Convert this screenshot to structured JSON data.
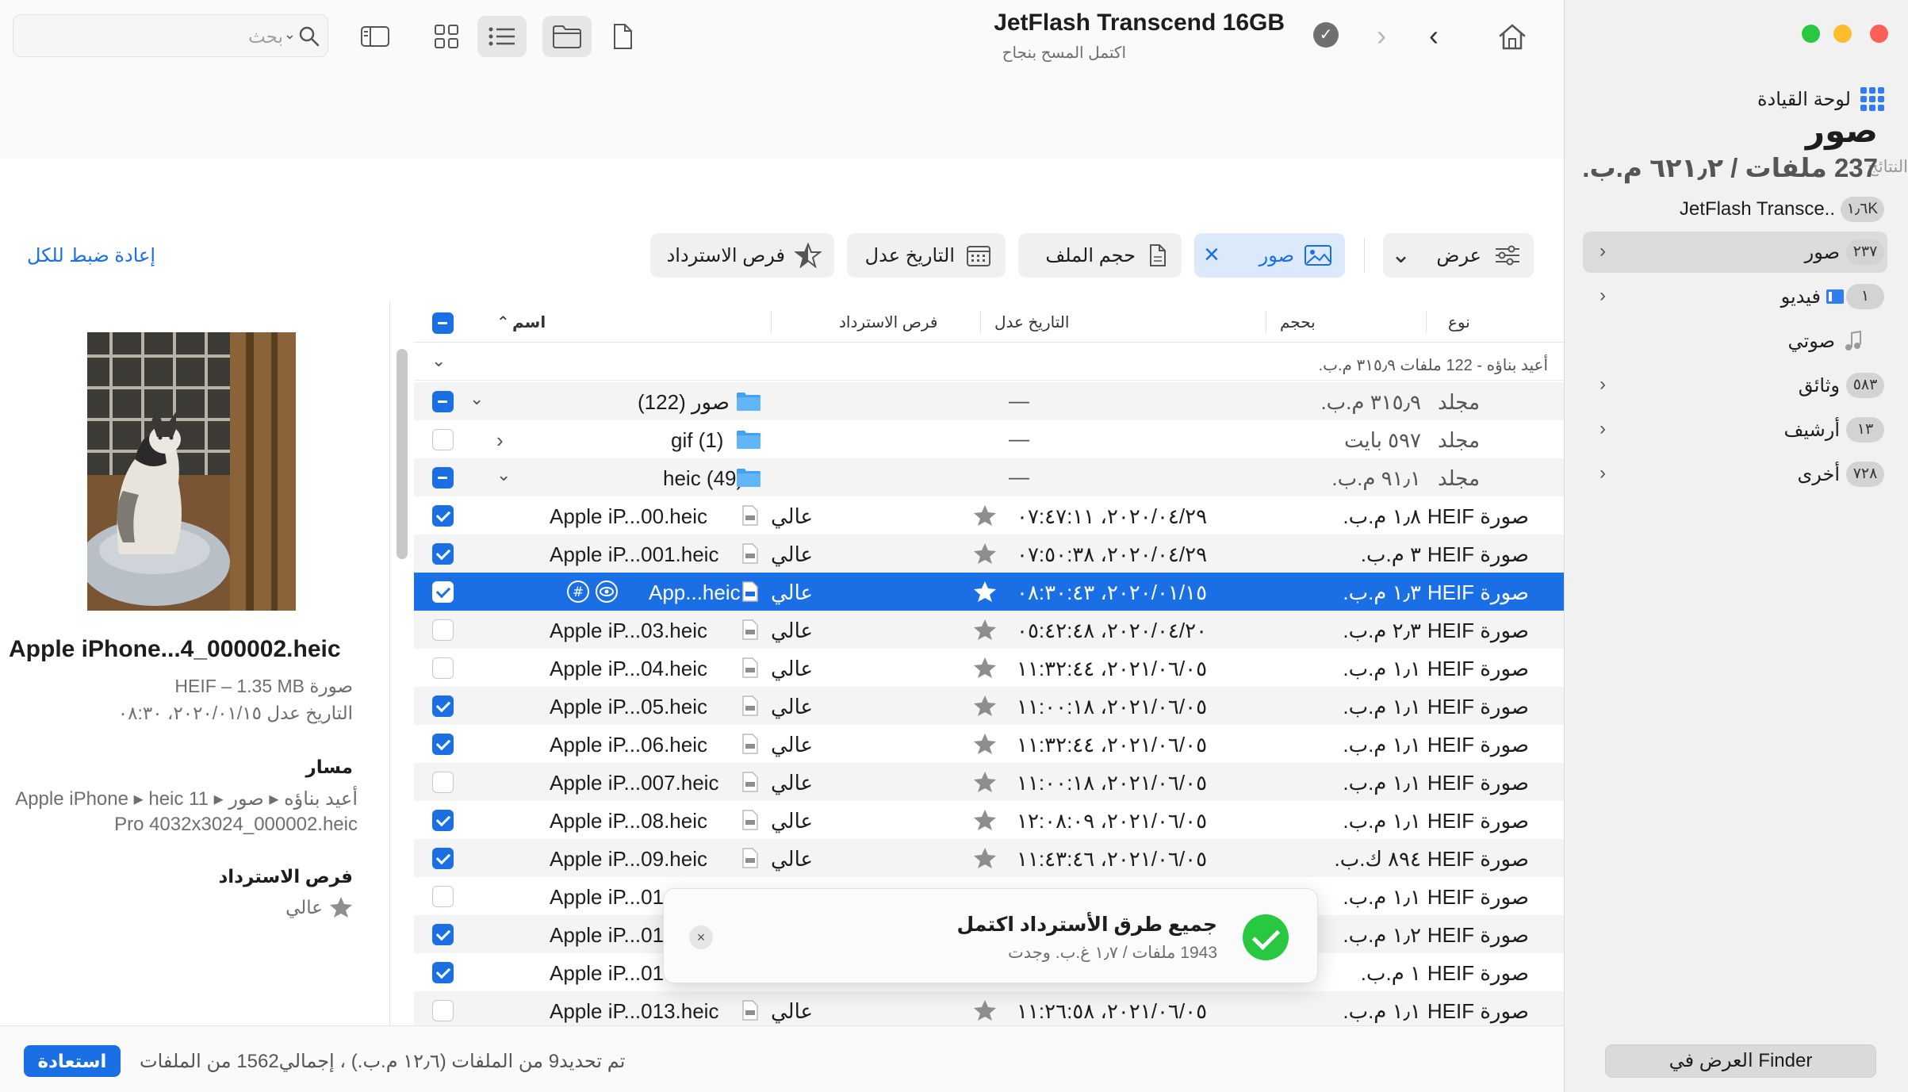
{
  "window": {
    "title": "JetFlash Transcend 16GB",
    "subtitle": "اكتمل المسح بنجاح",
    "search_placeholder": "بحث"
  },
  "page": {
    "title": "صور",
    "summary": "237 ملفات / ٦٢١٫٢ م.ب."
  },
  "sidebar": {
    "dashboard_label": "لوحة القيادة",
    "results_heading": "النتائج",
    "device": {
      "label": "JetFlash Transce..",
      "badge": "١٫٦K"
    },
    "items": [
      {
        "label": "صور",
        "badge": "٢٣٧"
      },
      {
        "label": "فيديو",
        "badge": "١"
      },
      {
        "label": "صوتي",
        "badge": ""
      },
      {
        "label": "وثائق",
        "badge": "٥٨٣"
      },
      {
        "label": "أرشيف",
        "badge": "١٣"
      },
      {
        "label": "أخرى",
        "badge": "٧٢٨"
      }
    ],
    "finder_button": "العرض في Finder"
  },
  "filters": {
    "view": "عرض",
    "photos": "صور",
    "file_size": "حجم الملف",
    "date_modified": "التاريخ عدل",
    "recovery_chances": "فرص الاسترداد",
    "reset_all": "إعادة ضبط للكل"
  },
  "columns": {
    "name": "اسم",
    "recovery": "فرص الاسترداد",
    "date": "التاريخ عدل",
    "size": "بحجم",
    "kind": "نوع"
  },
  "group_header": "أعيد بناؤه - 122 ملفات ٣١٥٫٩ م.ب.",
  "folder_rows": [
    {
      "name": "صور (122)",
      "dash": "—",
      "size": "٣١٥٫٩ م.ب.",
      "kind": "مجلد"
    },
    {
      "name": "gif (1)",
      "dash": "—",
      "size": "٥٩٧ بايت",
      "kind": "مجلد"
    },
    {
      "name": "heic (49)",
      "dash": "—",
      "size": "٩١٫١ م.ب.",
      "kind": "مجلد"
    }
  ],
  "file_rows": [
    {
      "name": "Apple iP...00.heic",
      "chance": "عالي",
      "date": "٢٠٢٠/٠٤/٢٩، ٠٧:٤٧:١١",
      "size": "١٫٨ م.ب.",
      "kind": "صورة HEIF"
    },
    {
      "name": "Apple iP...001.heic",
      "chance": "عالي",
      "date": "٢٠٢٠/٠٤/٢٩، ٠٧:٥٠:٣٨",
      "size": "٣ م.ب.",
      "kind": "صورة HEIF"
    },
    {
      "name": "App...heic",
      "chance": "عالي",
      "date": "٢٠٢٠/٠١/١٥، ٠٨:٣٠:٤٣",
      "size": "١٫٣ م.ب.",
      "kind": "صورة HEIF"
    },
    {
      "name": "Apple iP...03.heic",
      "chance": "عالي",
      "date": "٢٠٢٠/٠٤/٢٠، ٠٥:٤٢:٤٨",
      "size": "٢٫٣ م.ب.",
      "kind": "صورة HEIF"
    },
    {
      "name": "Apple iP...04.heic",
      "chance": "عالي",
      "date": "٢٠٢١/٠٦/٠٥، ١١:٣٢:٤٤",
      "size": "١٫١ م.ب.",
      "kind": "صورة HEIF"
    },
    {
      "name": "Apple iP...05.heic",
      "chance": "عالي",
      "date": "٢٠٢١/٠٦/٠٥، ١١:٠٠:١٨",
      "size": "١٫١ م.ب.",
      "kind": "صورة HEIF"
    },
    {
      "name": "Apple iP...06.heic",
      "chance": "عالي",
      "date": "٢٠٢١/٠٦/٠٥، ١١:٣٢:٤٤",
      "size": "١٫١ م.ب.",
      "kind": "صورة HEIF"
    },
    {
      "name": "Apple iP...007.heic",
      "chance": "عالي",
      "date": "٢٠٢١/٠٦/٠٥، ١١:٠٠:١٨",
      "size": "١٫١ م.ب.",
      "kind": "صورة HEIF"
    },
    {
      "name": "Apple iP...08.heic",
      "chance": "عالي",
      "date": "٢٠٢١/٠٦/٠٥، ١٢:٠٨:٠٩",
      "size": "١٫١ م.ب.",
      "kind": "صورة HEIF"
    },
    {
      "name": "Apple iP...09.heic",
      "chance": "عالي",
      "date": "٢٠٢١/٠٦/٠٥، ١١:٤٣:٤٦",
      "size": "٨٩٤ ك.ب.",
      "kind": "صورة HEIF"
    },
    {
      "name": "Apple iP...01",
      "chance": "",
      "date": "",
      "size": "١٫١ م.ب.",
      "kind": "صورة HEIF"
    },
    {
      "name": "Apple iP...01",
      "chance": "",
      "date": "",
      "size": "١٫٢ م.ب.",
      "kind": "صورة HEIF"
    },
    {
      "name": "Apple iP...01",
      "chance": "",
      "date": "",
      "size": "١ م.ب.",
      "kind": "صورة HEIF"
    },
    {
      "name": "Apple iP...013.heic",
      "chance": "عالي",
      "date": "٢٠٢١/٠٦/٠٥، ١١:٢٦:٥٨",
      "size": "١٫١ م.ب.",
      "kind": "صورة HEIF"
    }
  ],
  "preview": {
    "name": "Apple iPhone...4_000002.heic",
    "type_line": "صورة HEIF – 1.35 MB",
    "date_line": "التاريخ عدل ٢٠٢٠/٠١/١٥، ٠٨:٣٠",
    "path_heading": "مسار",
    "path_value": "أعيد بناؤه ▸ صور ▸ Apple iPhone ▸ heic 11 Pro 4032x3024_000002.heic",
    "recovery_heading": "فرص الاسترداد",
    "recovery_value": "عالي"
  },
  "toast": {
    "title": "جميع طرق الأسترداد اكتمل",
    "subtitle": "1943 ملفات / ١٫٧ غ.ب. وجدت"
  },
  "footer": {
    "restore": "استعادة",
    "status": "تم تحديد9 من الملفات (١٢٫٦ م.ب.) ، إجمالي1562 من الملفات"
  },
  "colors": {
    "accent": "#1a6fe5",
    "success": "#28c840",
    "folder": "#3ea1f1"
  }
}
